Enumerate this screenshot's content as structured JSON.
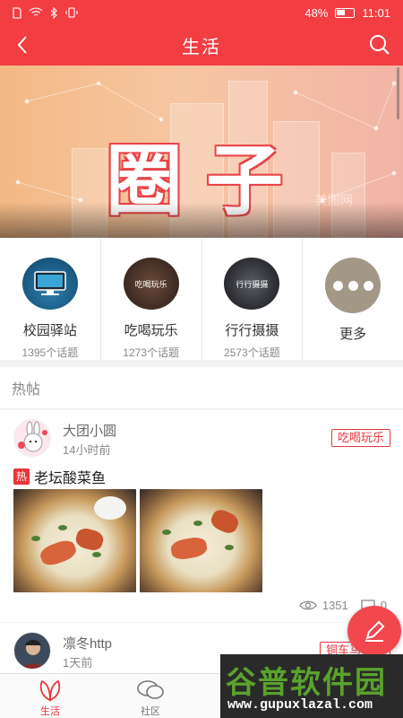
{
  "status_bar": {
    "battery": "48%",
    "time": "11:01"
  },
  "app_bar": {
    "title": "生活"
  },
  "banner": {
    "headline": "圈子",
    "faint_text": "美图网"
  },
  "categories": [
    {
      "name": "校园驿站",
      "count": "1395个话题",
      "icon": ""
    },
    {
      "name": "吃喝玩乐",
      "count": "1273个话题",
      "icon": "吃喝玩乐"
    },
    {
      "name": "行行摄摄",
      "count": "2573个话题",
      "icon": "行行摄摄"
    },
    {
      "name": "更多",
      "count": "",
      "icon": "more-dots-icon"
    }
  ],
  "hot_section": {
    "title": "热帖"
  },
  "posts": [
    {
      "author": "大团小圆",
      "time": "14小时前",
      "tag": "吃喝玩乐",
      "hot_badge": "热",
      "title": "老坛酸菜鱼",
      "views": "1351",
      "comments": "0"
    },
    {
      "author": "凛冬http",
      "time": "1天前",
      "tag": "铜车马社区"
    }
  ],
  "tabs": [
    {
      "label": "生活",
      "active": true
    },
    {
      "label": "社区",
      "active": false
    }
  ],
  "watermark": {
    "brand": "谷普软件园",
    "url": "www.gupuxlazal.com"
  },
  "colors": {
    "primary": "#f23d42",
    "tag_red": "#e8353b"
  }
}
